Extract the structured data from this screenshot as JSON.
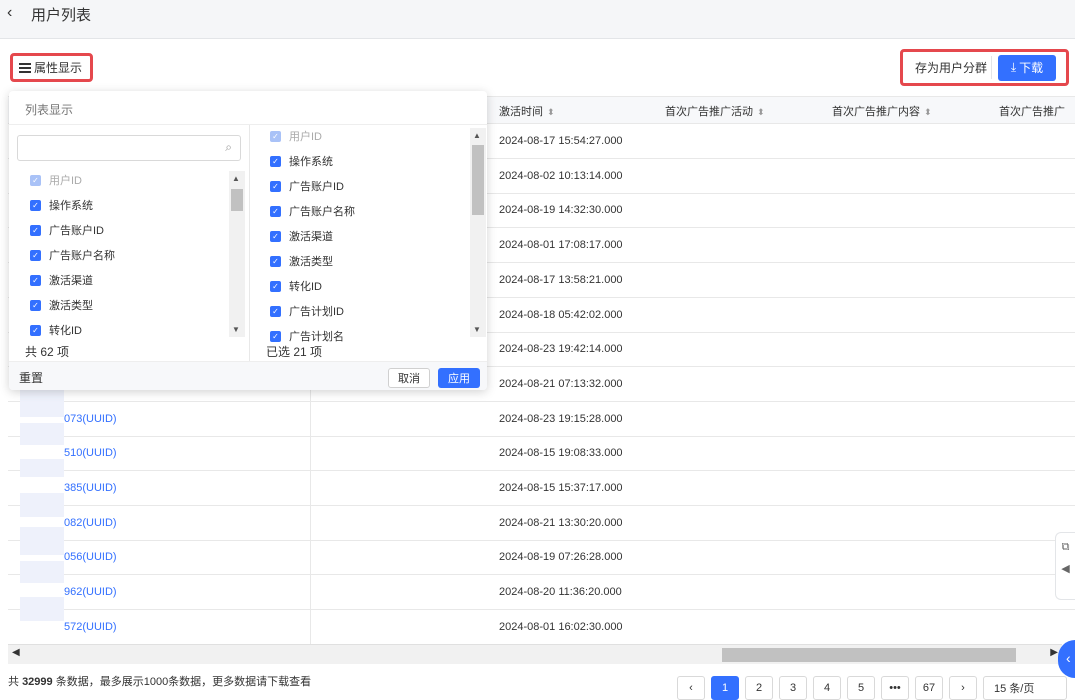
{
  "header": {
    "back_icon": "chevron-left-icon",
    "title": "用户列表"
  },
  "toolbar": {
    "attr_display_label": "属性显示",
    "save_segment_label": "存为用户分群",
    "download_label": "下载"
  },
  "table": {
    "headers": [
      "激活时间",
      "首次广告推广活动",
      "首次广告推广内容",
      "首次广告推广"
    ],
    "rows": [
      {
        "id": "",
        "time": "2024-08-17 15:54:27.000"
      },
      {
        "id": "",
        "time": "2024-08-02 10:13:14.000"
      },
      {
        "id": "",
        "time": "2024-08-19 14:32:30.000"
      },
      {
        "id": "",
        "time": "2024-08-01 17:08:17.000"
      },
      {
        "id": "",
        "time": "2024-08-17 13:58:21.000"
      },
      {
        "id": "",
        "time": "2024-08-18 05:42:02.000"
      },
      {
        "id": "",
        "time": "2024-08-23 19:42:14.000"
      },
      {
        "id": "",
        "time": "2024-08-21 07:13:32.000"
      },
      {
        "id": "073(UUID)",
        "time": "2024-08-23 19:15:28.000"
      },
      {
        "id": "510(UUID)",
        "time": "2024-08-15 19:08:33.000"
      },
      {
        "id": "385(UUID)",
        "time": "2024-08-15 15:37:17.000"
      },
      {
        "id": "082(UUID)",
        "time": "2024-08-21 13:30:20.000"
      },
      {
        "id": "056(UUID)",
        "time": "2024-08-19 07:26:28.000"
      },
      {
        "id": "962(UUID)",
        "time": "2024-08-20 11:36:20.000"
      },
      {
        "id": "572(UUID)",
        "time": "2024-08-01 16:02:30.000"
      }
    ]
  },
  "column_popover": {
    "title": "列表显示",
    "search_placeholder": "",
    "left_items": [
      {
        "label": "用户ID",
        "disabled": true
      },
      {
        "label": "操作系统"
      },
      {
        "label": "广告账户ID"
      },
      {
        "label": "广告账户名称"
      },
      {
        "label": "激活渠道"
      },
      {
        "label": "激活类型"
      },
      {
        "label": "转化ID"
      }
    ],
    "right_items": [
      {
        "label": "用户ID",
        "disabled": true
      },
      {
        "label": "操作系统"
      },
      {
        "label": "广告账户ID"
      },
      {
        "label": "广告账户名称"
      },
      {
        "label": "激活渠道"
      },
      {
        "label": "激活类型"
      },
      {
        "label": "转化ID"
      },
      {
        "label": "广告计划ID"
      },
      {
        "label": "广告计划名"
      }
    ],
    "total_label": "共 62 项",
    "selected_label": "已选 21 项",
    "reset_label": "重置",
    "cancel_label": "取消",
    "apply_label": "应用"
  },
  "footer": {
    "prefix": "共 ",
    "total": "32999",
    "suffix": " 条数据，最多展示1000条数据，更多数据请下载查看"
  },
  "pagination": {
    "pages": [
      "1",
      "2",
      "3",
      "4",
      "5",
      "•••",
      "67"
    ],
    "current": "1",
    "page_size": "15 条/页"
  },
  "colors": {
    "accent": "#3370ff",
    "highlight": "#e5484d"
  }
}
